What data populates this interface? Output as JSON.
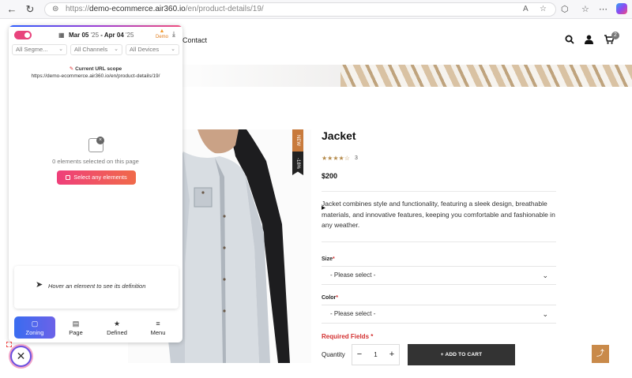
{
  "browser": {
    "url_scheme": "https://",
    "url_domain": "demo-ecommerce.air360.io",
    "url_path": "/en/product-details/19/",
    "icons": [
      "back-icon",
      "refresh-icon",
      "lock-icon",
      "read-aloud-icon",
      "favorite-icon",
      "extensions-icon",
      "collections-icon",
      "profile-icon",
      "more-icon",
      "copilot-icon"
    ]
  },
  "site": {
    "nav_contact": "Contact",
    "cart_count": "2",
    "product": {
      "title": "Jacket",
      "stars": "★★★★☆",
      "rating_count": "3",
      "price": "$200",
      "ribbon_new": "NEW",
      "ribbon_off": "-18%",
      "description": "Jacket combines style and functionality, featuring a sleek design, breathable materials, and innovative features, keeping you comfortable and fashionable in any weather.",
      "size_label": "Size",
      "size_placeholder": "- Please select -",
      "color_label": "Color",
      "color_placeholder": "- Please select -",
      "required_fields": "Required Fields",
      "required_mark": "*",
      "quantity_label": "Quantity",
      "quantity_minus": "−",
      "quantity_value": "1",
      "quantity_plus": "+",
      "add_to_cart": "+ ADD TO CART"
    },
    "scroll_top_icon": "⤴"
  },
  "panel": {
    "date_from": "Mar 05",
    "date_from_year": "'25",
    "date_sep": "-",
    "date_to": "Apr 04",
    "date_to_year": "'25",
    "demo_label": "Demo",
    "filters": [
      "All Segme...",
      "All Channels",
      "All Devices"
    ],
    "scope_title": "Current URL scope",
    "scope_url": "https://demo-ecommerce.air360.io/en/product-details/19/",
    "empty_text": "0 elements selected on this page",
    "select_button": "Select any elements",
    "hover_hint": "Hover an element to see its definition",
    "tabs": [
      {
        "label": "Zoning",
        "icon": "▢"
      },
      {
        "label": "Page",
        "icon": "▤"
      },
      {
        "label": "Defined",
        "icon": "★"
      },
      {
        "label": "Menu",
        "icon": "≡"
      }
    ],
    "active_tab": "Zoning",
    "colors": {
      "accent_pink": "#ef3f7a",
      "accent_blue": "#3a6cf0",
      "ribbon_orange": "#c87a3c"
    }
  }
}
